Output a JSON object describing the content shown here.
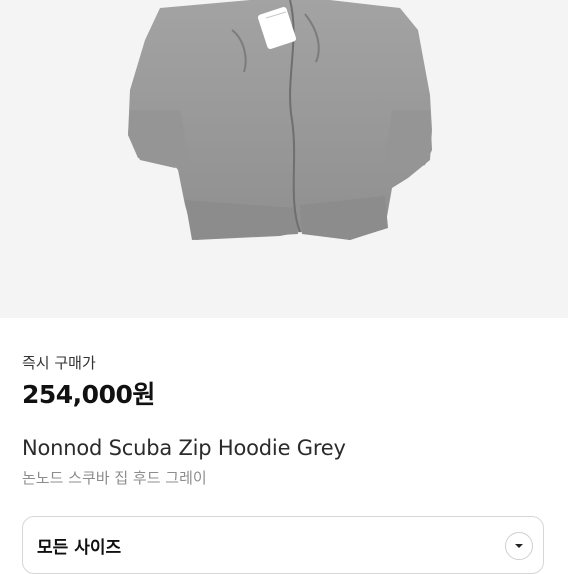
{
  "hero": {
    "image_subject": "grey zip hoodie product photo"
  },
  "purchase": {
    "label": "즉시 구매가",
    "price": "254,000원"
  },
  "product": {
    "name": "Nonnod Scuba Zip Hoodie Grey",
    "name_korean": "논노드 스쿠바 집 후드 그레이"
  },
  "size_selector": {
    "label": "모든 사이즈",
    "icon": "chevron-down-icon"
  },
  "colors": {
    "hero_bg": "#f4f4f4",
    "hoodie": "#9b9b9b",
    "text_muted": "#8d8d8d"
  }
}
